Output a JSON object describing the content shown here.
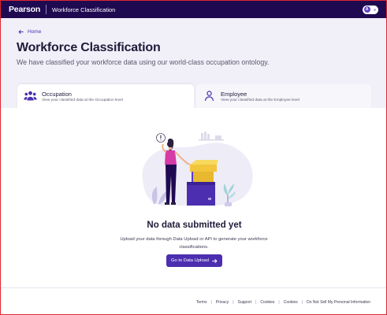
{
  "header": {
    "brand": "Pearson",
    "app_title": "Workforce Classification",
    "toggle_initial": "A"
  },
  "hero": {
    "back_label": "Home",
    "title": "Workforce Classification",
    "subtitle": "We have classified your workforce data using our world-class occupation ontology."
  },
  "tabs": [
    {
      "title": "Occupation",
      "description": "View your classified data at the Occupation level",
      "active": true,
      "icon": "people-icon"
    },
    {
      "title": "Employee",
      "description": "View your classified data at the Employee level",
      "active": false,
      "icon": "person-icon"
    }
  ],
  "empty_state": {
    "title": "No data submitted yet",
    "description": "Upload your data through Data Upload or API to generate your workforce classifications.",
    "cta_label": "Go to Data Upload",
    "illustration": "person-with-boxes-illustration"
  },
  "footer": {
    "links": [
      "Terms",
      "Privacy",
      "Support",
      "Cookies",
      "Cookies",
      "Do Not Sell My Personal Information"
    ]
  },
  "colors": {
    "navbar": "#1f0a52",
    "accent": "#4b2fb0",
    "hero_bg": "#f1eff8",
    "frame_border": "#e0262f"
  }
}
